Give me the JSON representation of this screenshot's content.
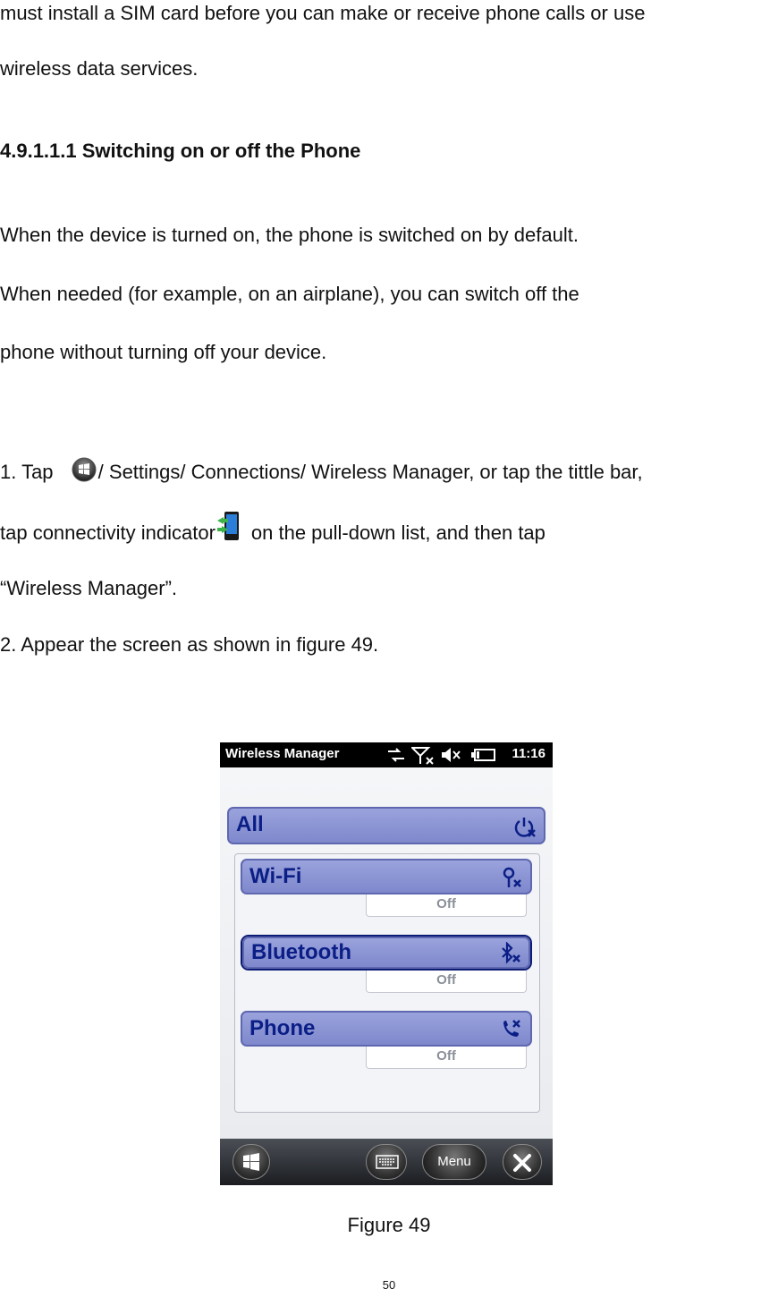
{
  "page": {
    "para1_line1": "must install a SIM card before you can make or receive phone calls or use",
    "para1_line2": "wireless data services.",
    "heading": "4.9.1.1.1 Switching on or off the Phone",
    "para2_line1": "When the device is turned on, the phone is switched on by default.",
    "para2_line2": "When needed (for example, on an airplane), you can switch off the",
    "para2_line3": "phone without turning off your device.",
    "step1_prefix": "1. Tap",
    "step1_line1_rest": "/ Settings/ Connections/ Wireless Manager, or tap the tittle bar,",
    "step1_line2_prefix": "tap connectivity indicator",
    "step1_line2_rest": "on the pull-down list, and then tap",
    "step1_line3": "“Wireless Manager”.",
    "step2": "2. Appear the screen as shown in figure 49.",
    "caption": "Figure 49",
    "page_number": "50"
  },
  "device": {
    "title": "Wireless Manager",
    "time": "11:16",
    "all_label": "All",
    "wifi_label": "Wi-Fi",
    "wifi_state": "Off",
    "bluetooth_label": "Bluetooth",
    "bluetooth_state": "Off",
    "phone_label": "Phone",
    "phone_state": "Off",
    "menu_label": "Menu"
  },
  "colors": {
    "bar": "#8a93d4",
    "bar_text": "#0b1e86",
    "statusbar": "#000000"
  }
}
